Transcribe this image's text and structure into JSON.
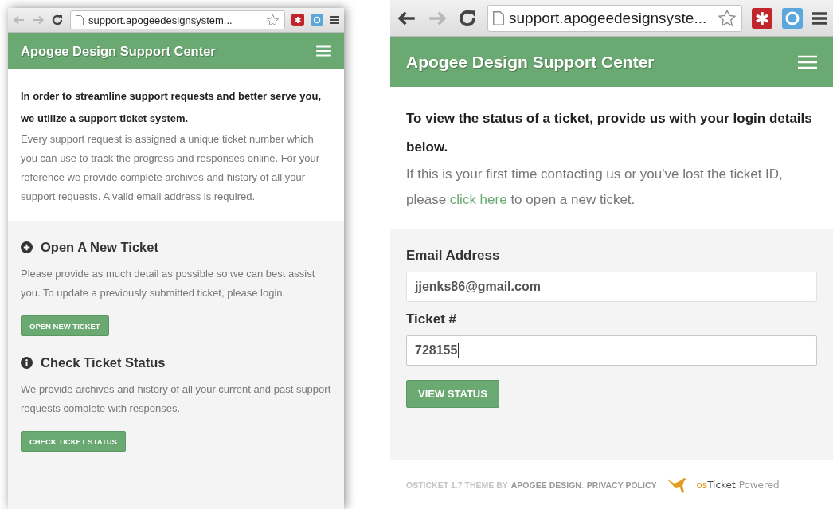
{
  "windows": [
    {
      "kind": "home",
      "back_disabled": true,
      "forward_disabled": true,
      "address": "support.apogeedesignsystem...",
      "site_title": "Apogee Design Support Center",
      "intro": {
        "lead": "In order to streamline support requests and better serve you, we utilize a support ticket system.",
        "body": "Every support request is assigned a unique ticket number which you can use to track the progress and responses online. For your reference we provide complete archives and history of all your support requests. A valid email address is required."
      },
      "sections": [
        {
          "kind": "open",
          "heading": "Open A New Ticket",
          "text": "Please provide as much detail as possible so we can best assist you. To update a previously submitted ticket, please login.",
          "button": "OPEN NEW TICKET"
        },
        {
          "kind": "check",
          "heading": "Check Ticket Status",
          "text": "We provide archives and history of all your current and past support requests complete with responses.",
          "button": "CHECK TICKET STATUS"
        }
      ]
    },
    {
      "kind": "status",
      "back_disabled": false,
      "forward_disabled": true,
      "address": "support.apogeedesignsyste...",
      "site_title": "Apogee Design Support Center",
      "intro": {
        "lead": "To view the status of a ticket, provide us with your login details below.",
        "body_before": "If this is your first time contacting us or you've lost the ticket ID, please",
        "link": "click here",
        "body_after": "to open a new ticket."
      },
      "form": {
        "fields": [
          {
            "label": "Email Address",
            "value": "jjenks86@gmail.com",
            "focused": false
          },
          {
            "label": "Ticket #",
            "value": "728155",
            "focused": true
          }
        ],
        "button": "VIEW STATUS"
      },
      "footer": {
        "credit": "OSTICKET 1.7 THEME BY",
        "author_link": "APOGEE DESIGN",
        "separator": ".",
        "policy_link": "PRIVACY POLICY",
        "brand_prefix": "os",
        "brand": "Ticket",
        "powered": "Powered"
      }
    }
  ]
}
